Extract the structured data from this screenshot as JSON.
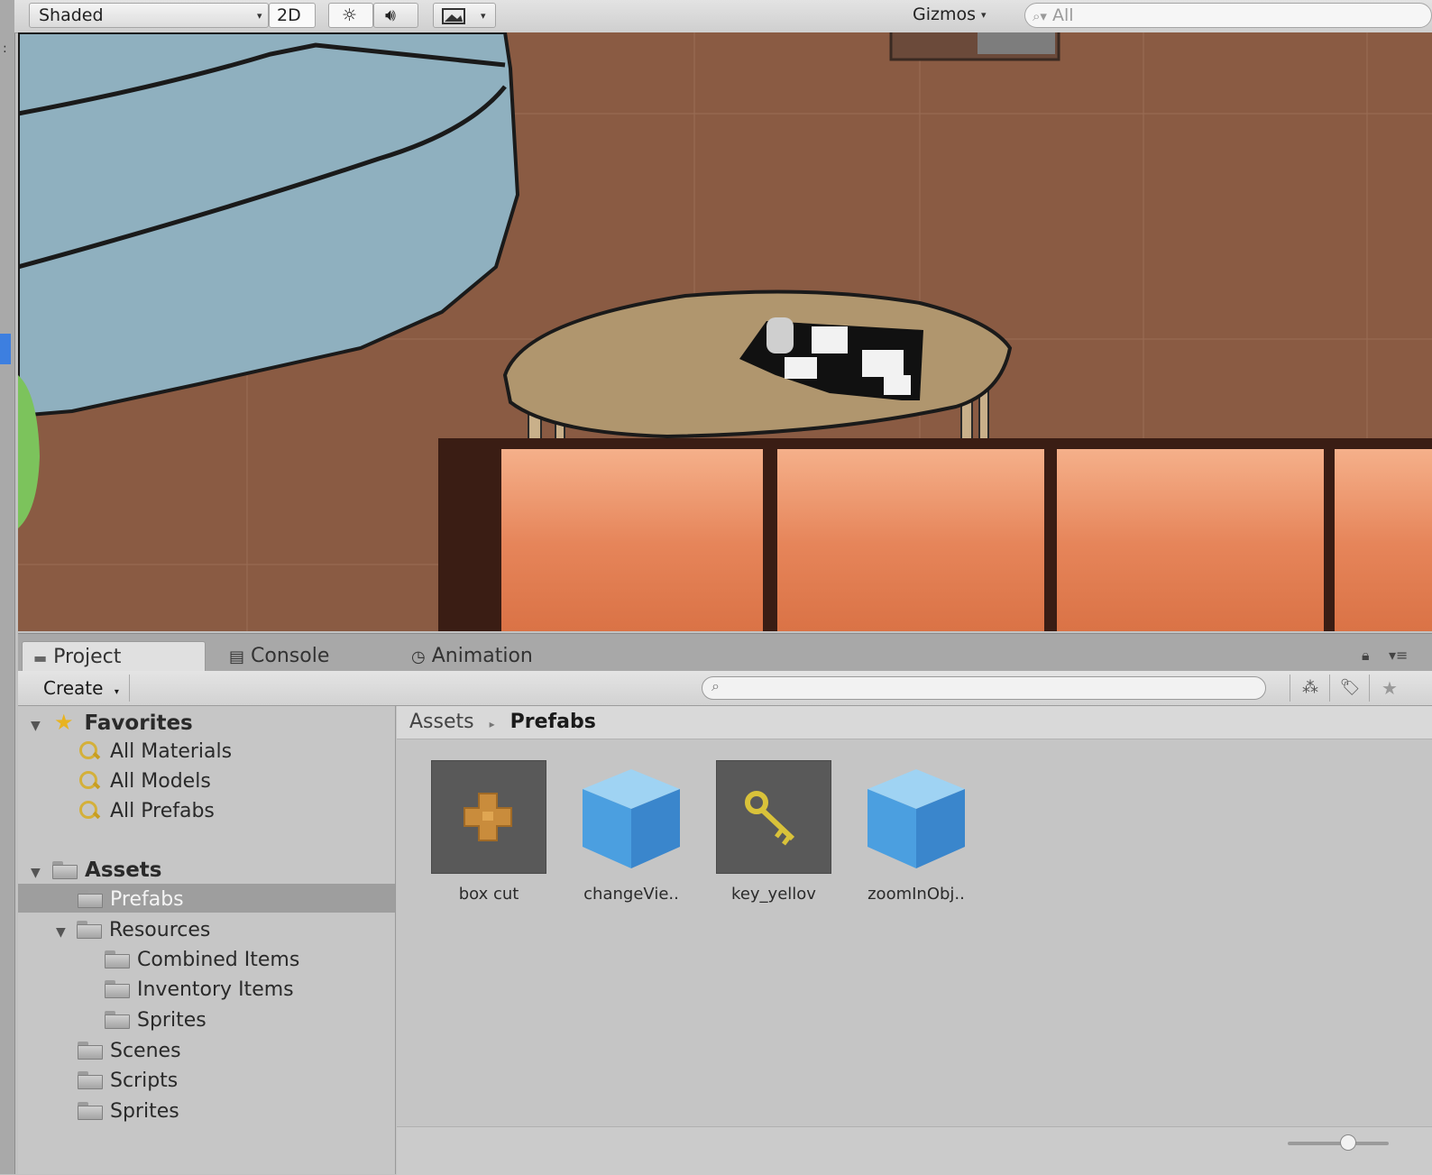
{
  "scene_toolbar": {
    "shading_mode": "Shaded",
    "two_d_label": "2D",
    "gizmos_label": "Gizmos",
    "search_value": "All"
  },
  "bottom_panel": {
    "tabs": [
      {
        "label": "Project",
        "icon": "folder-icon"
      },
      {
        "label": "Console",
        "icon": "console-icon"
      },
      {
        "label": "Animation",
        "icon": "clock-icon"
      }
    ],
    "create_label": "Create"
  },
  "tree": {
    "favorites_label": "Favorites",
    "favorites_items": [
      "All Materials",
      "All Models",
      "All Prefabs"
    ],
    "assets_label": "Assets",
    "assets_items": {
      "prefabs": "Prefabs",
      "resources": "Resources",
      "combined_items": "Combined Items",
      "inventory_items": "Inventory Items",
      "resources_sprites": "Sprites",
      "scenes": "Scenes",
      "scripts": "Scripts",
      "sprites": "Sprites"
    }
  },
  "breadcrumb": {
    "root": "Assets",
    "current": "Prefabs"
  },
  "assets": [
    {
      "label": "box cut",
      "icon": "box-cut-icon"
    },
    {
      "label": "changeVie..",
      "icon": "prefab-cube-icon"
    },
    {
      "label": "key_yellov",
      "icon": "key-icon"
    },
    {
      "label": "zoomInObj..",
      "icon": "prefab-cube-icon"
    }
  ],
  "colors": {
    "selection": "#9e9e9e",
    "scene_floor": "#8a5b43",
    "cabinet": "#e8885c"
  },
  "zoom_slider_fraction": 0.6
}
